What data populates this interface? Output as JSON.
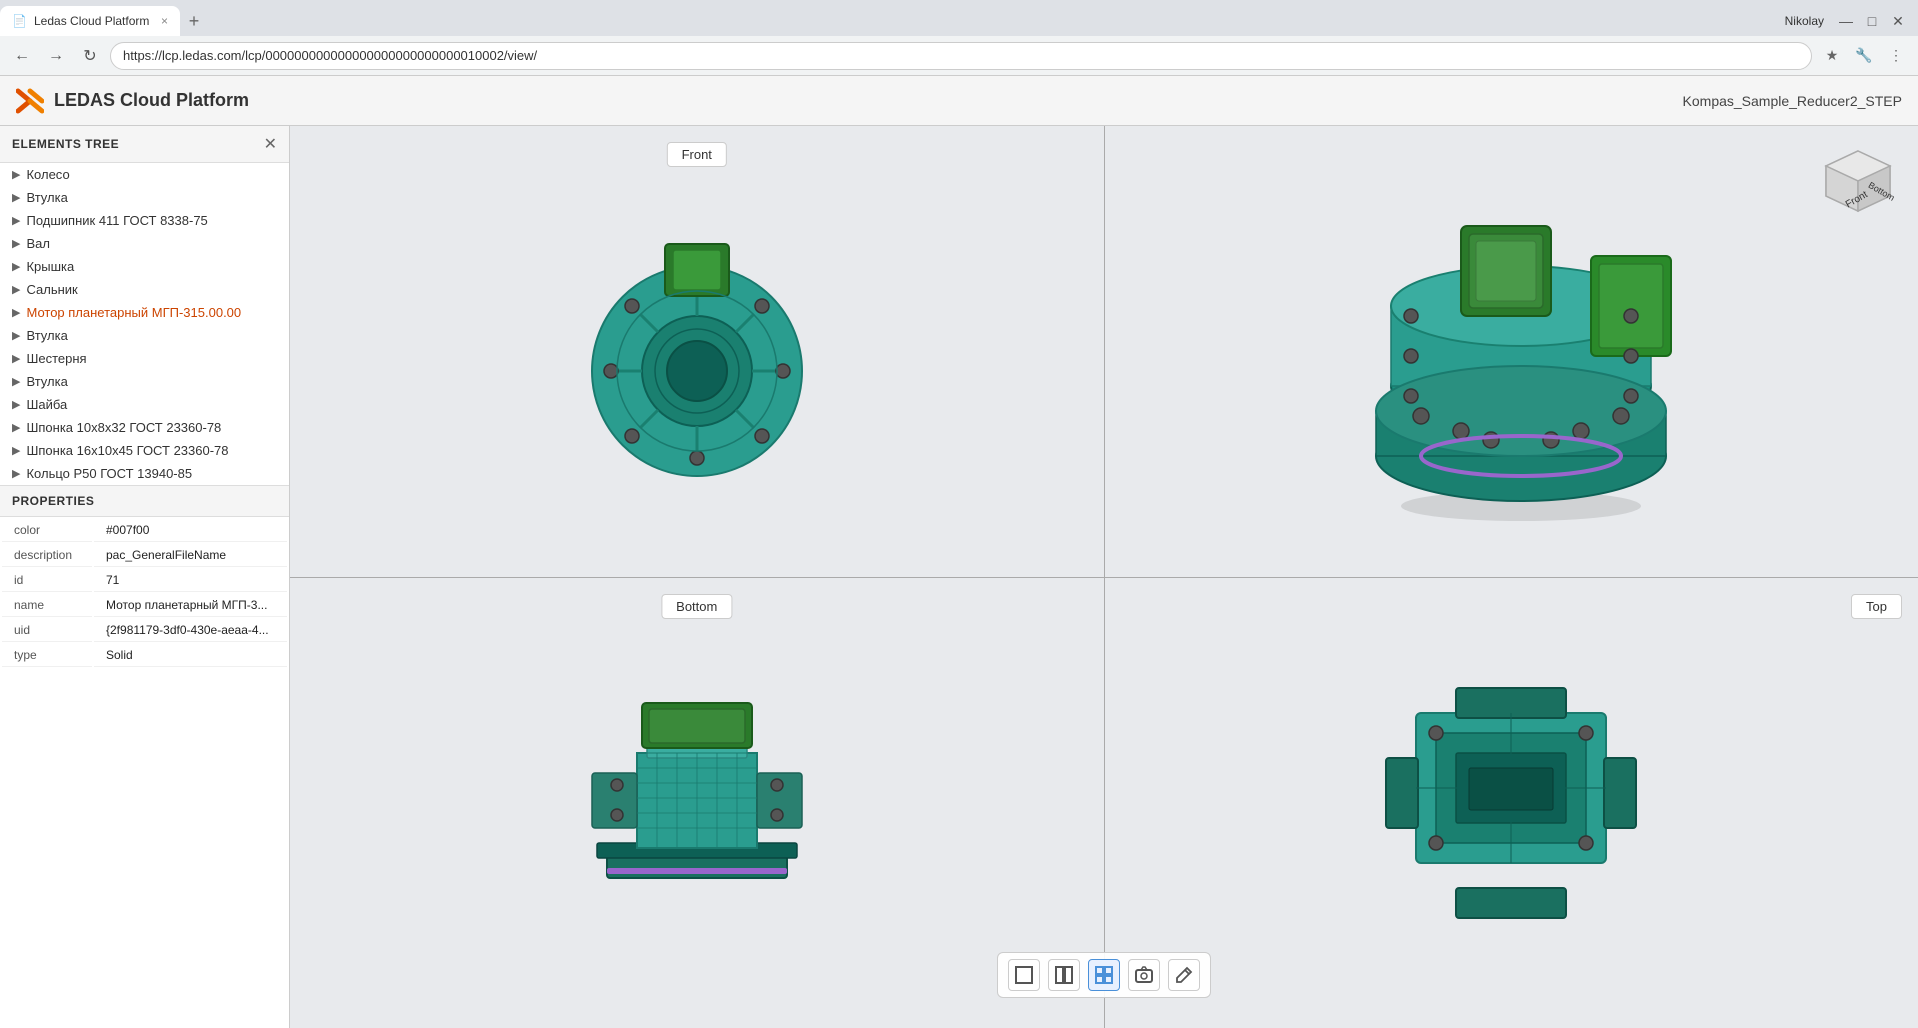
{
  "browser": {
    "tab_title": "Ledas Cloud Platform",
    "url": "https://lcp.ledas.com/lcp/000000000000000000000000000010002/view/",
    "user": "Nikolay",
    "tab_close": "×",
    "tab_new": "+"
  },
  "app": {
    "title": "LEDAS Cloud Platform",
    "filename": "Kompas_Sample_Reducer2_STEP"
  },
  "elements_tree": {
    "header": "ELEMENTS TREE",
    "items": [
      {
        "label": "Колесо",
        "highlighted": false
      },
      {
        "label": "Втулка",
        "highlighted": false
      },
      {
        "label": "Подшипник 411 ГОСТ 8338-75",
        "highlighted": false
      },
      {
        "label": "Вал",
        "highlighted": false
      },
      {
        "label": "Крышка",
        "highlighted": false
      },
      {
        "label": "Сальник",
        "highlighted": false
      },
      {
        "label": "Мотор планетарный МГП-315.00.00",
        "highlighted": true
      },
      {
        "label": "Втулка",
        "highlighted": false
      },
      {
        "label": "Шестерня",
        "highlighted": false
      },
      {
        "label": "Втулка",
        "highlighted": false
      },
      {
        "label": "Шайба",
        "highlighted": false
      },
      {
        "label": "Шпонка 10х8х32 ГОСТ 23360-78",
        "highlighted": false
      },
      {
        "label": "Шпонка 16х10х45 ГОСТ 23360-78",
        "highlighted": false
      },
      {
        "label": "Кольцо Р50 ГОСТ 13940-85",
        "highlighted": false
      }
    ]
  },
  "properties": {
    "header": "PROPERTIES",
    "rows": [
      {
        "key": "color",
        "value": "#007f00"
      },
      {
        "key": "description",
        "value": "pac_GeneralFileName"
      },
      {
        "key": "id",
        "value": "71"
      },
      {
        "key": "name",
        "value": "Мотор планетарный МГП-3..."
      },
      {
        "key": "uid",
        "value": "{2f981179-3df0-430e-aeaa-4..."
      },
      {
        "key": "type",
        "value": "Solid"
      }
    ]
  },
  "viewports": {
    "front_label": "Front",
    "bottom_label": "Bottom",
    "top_label": "Top"
  },
  "toolbar": {
    "layout1_label": "single-view",
    "layout2_label": "split-view",
    "layout4_label": "quad-view",
    "camera_label": "camera",
    "edit_label": "edit"
  },
  "nav_cube": {
    "front": "Front",
    "bottom": "Bottom"
  }
}
